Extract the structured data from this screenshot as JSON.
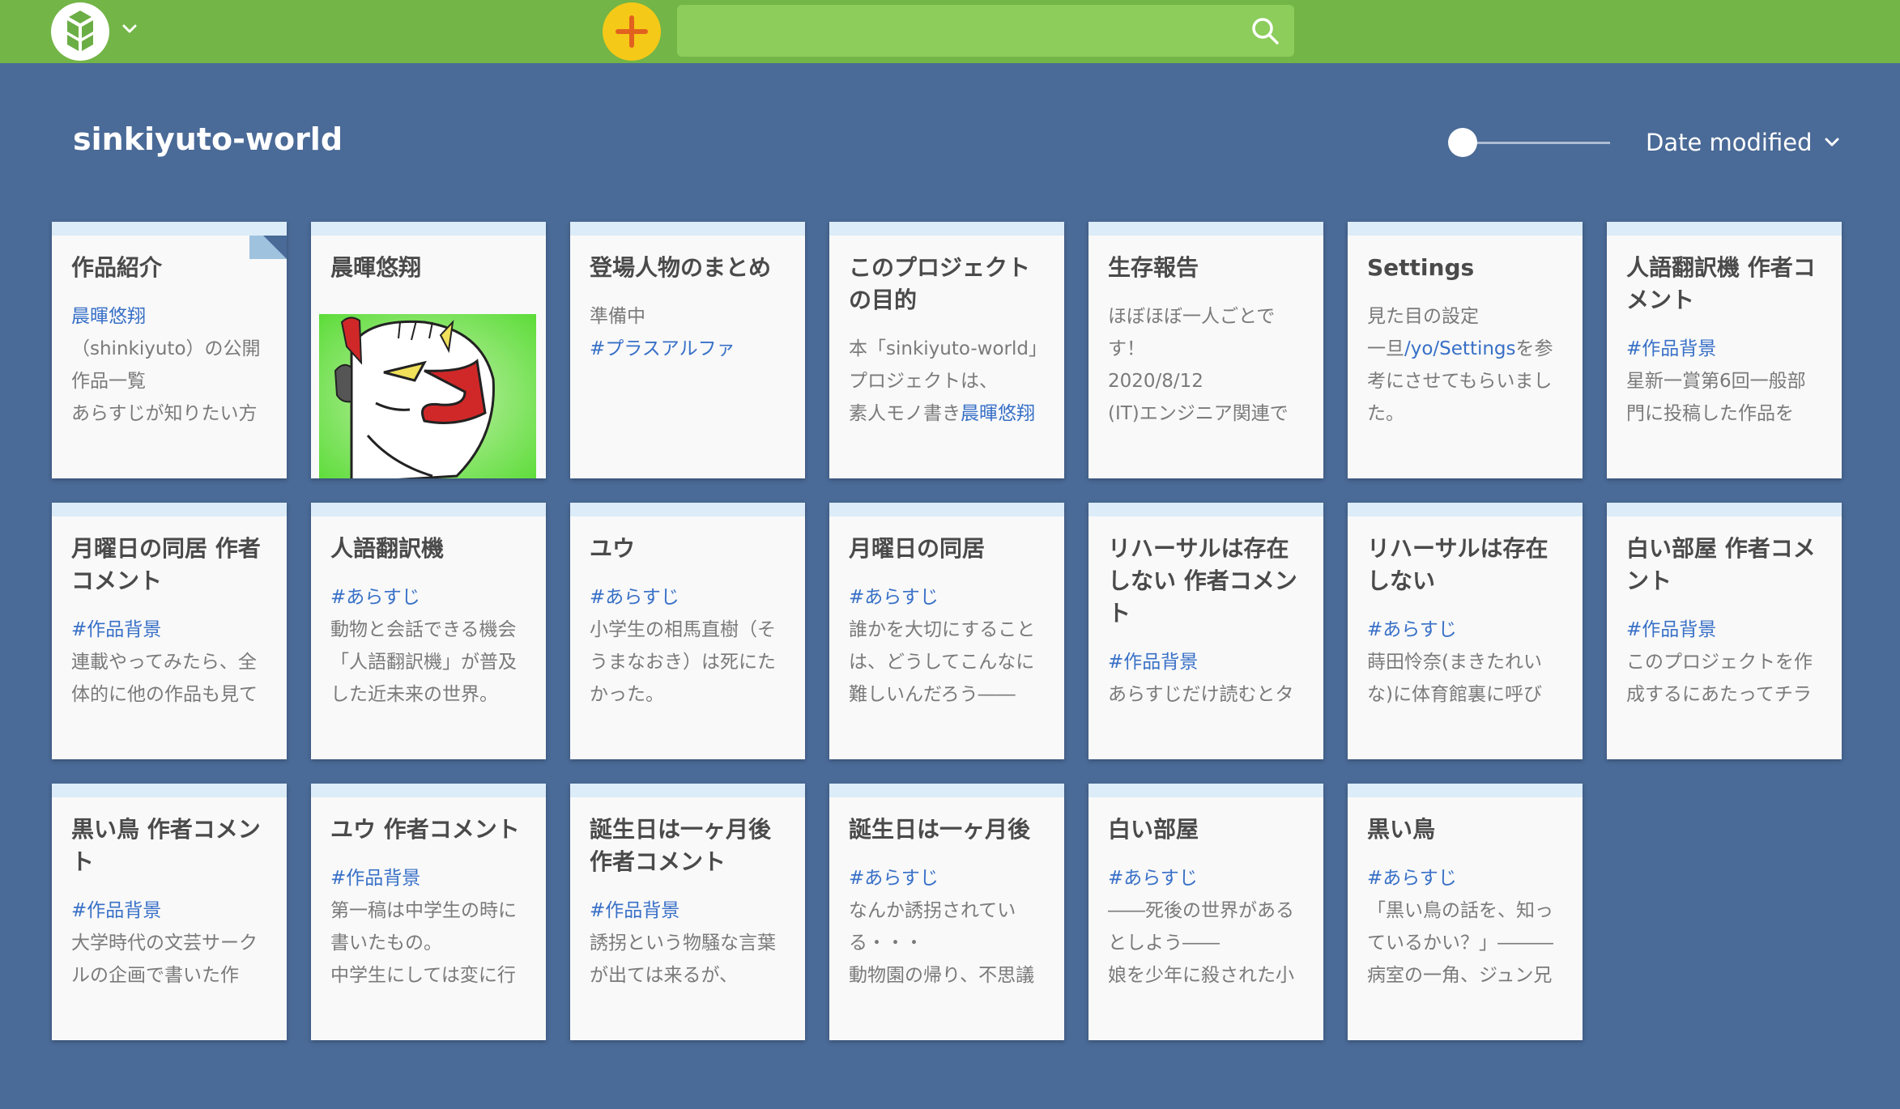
{
  "header": {
    "logo_icon": "gyazo-style-logo-icon",
    "add_icon": "plus-icon",
    "search": {
      "value": "",
      "placeholder": ""
    },
    "search_icon": "search-icon"
  },
  "project": {
    "title": "sinkiyuto-world",
    "sort_label": "Date modified"
  },
  "colors": {
    "topbar": "#73b547",
    "search_bg": "#8ccd5b",
    "add_button": "#f5c918",
    "background": "#4a6a97",
    "card_header": "#dcecf8",
    "link": "#3870c7"
  },
  "cards": [
    {
      "title": "作品紹介",
      "lines": [
        [
          "link:晨暉悠翔"
        ],
        [
          "（shinkiyuto）の公開"
        ],
        [
          "作品一覧"
        ],
        [
          "あらすじが知りたい方"
        ]
      ],
      "dogear": true
    },
    {
      "title": "晨暉悠翔",
      "image": "mask-portrait-illustration"
    },
    {
      "title": "登場人物のまとめ",
      "lines": [
        [
          "準備中"
        ],
        [
          "link:#プラスアルファ"
        ]
      ]
    },
    {
      "title": "このプロジェクトの目的",
      "lines": [
        [
          "本「sinkiyuto-world」"
        ],
        [
          "プロジェクトは、"
        ],
        [
          "素人モノ書き",
          "link:晨暉悠翔"
        ]
      ]
    },
    {
      "title": "生存報告",
      "lines": [
        [
          "ほぼほぼ一人ごとで"
        ],
        [
          "す！"
        ],
        [
          "2020/8/12"
        ],
        [
          "(IT)エンジニア関連で"
        ]
      ]
    },
    {
      "title": "Settings",
      "lines": [
        [
          "見た目の設定"
        ],
        [
          "一旦",
          "link:/yo/Settings",
          "を参"
        ],
        [
          "考にさせてもらいまし"
        ],
        [
          "た。"
        ]
      ]
    },
    {
      "title": "人語翻訳機 作者コメント",
      "lines": [
        [
          "link:#作品背景"
        ],
        [
          "星新一賞第6回一般部"
        ],
        [
          "門に投稿した作品を"
        ]
      ]
    },
    {
      "title": "月曜日の同居 作者コメント",
      "lines": [
        [
          "link:#作品背景"
        ],
        [
          "連載やってみたら、全"
        ],
        [
          "体的に他の作品も見て"
        ]
      ]
    },
    {
      "title": "人語翻訳機",
      "lines": [
        [
          "link:#あらすじ"
        ],
        [
          "動物と会話できる機会"
        ],
        [
          "「人語翻訳機」が普及"
        ],
        [
          "した近未来の世界。"
        ]
      ]
    },
    {
      "title": "ユウ",
      "lines": [
        [
          "link:#あらすじ"
        ],
        [
          "小学生の相馬直樹（そ"
        ],
        [
          "うまなおき）は死にた"
        ],
        [
          "かった。"
        ]
      ]
    },
    {
      "title": "月曜日の同居",
      "lines": [
        [
          "link:#あらすじ"
        ],
        [
          "誰かを大切にすること"
        ],
        [
          "は、どうしてこんなに"
        ],
        [
          "難しいんだろう――"
        ]
      ]
    },
    {
      "title": "リハーサルは存在しない 作者コメント",
      "lines": [
        [
          "link:#作品背景"
        ],
        [
          "あらすじだけ読むとタ"
        ]
      ]
    },
    {
      "title": "リハーサルは存在しない",
      "lines": [
        [
          "link:#あらすじ"
        ],
        [
          "蒔田怜奈(まきたれい"
        ],
        [
          "な)に体育館裏に呼び"
        ]
      ]
    },
    {
      "title": "白い部屋 作者コメント",
      "lines": [
        [
          "link:#作品背景"
        ],
        [
          "このプロジェクトを作"
        ],
        [
          "成するにあたってチラ"
        ]
      ]
    },
    {
      "title": "黒い鳥 作者コメント",
      "lines": [
        [
          "link:#作品背景"
        ],
        [
          "大学時代の文芸サーク"
        ],
        [
          "ルの企画で書いた作"
        ]
      ]
    },
    {
      "title": "ユウ 作者コメント",
      "lines": [
        [
          "link:#作品背景"
        ],
        [
          "第一稿は中学生の時に"
        ],
        [
          "書いたもの。"
        ],
        [
          "中学生にしては変に行"
        ]
      ]
    },
    {
      "title": "誕生日は一ヶ月後 作者コメント",
      "lines": [
        [
          "link:#作品背景"
        ],
        [
          "誘拐という物騒な言葉"
        ],
        [
          "が出ては来るが、"
        ]
      ]
    },
    {
      "title": "誕生日は一ヶ月後",
      "lines": [
        [
          "link:#あらすじ"
        ],
        [
          "なんか誘拐されてい"
        ],
        [
          "る・・・"
        ],
        [
          "動物園の帰り、不思議"
        ]
      ]
    },
    {
      "title": "白い部屋",
      "lines": [
        [
          "link:#あらすじ"
        ],
        [
          "――死後の世界がある"
        ],
        [
          "としよう――"
        ],
        [
          "娘を少年に殺された小"
        ]
      ]
    },
    {
      "title": "黒い鳥",
      "lines": [
        [
          "link:#あらすじ"
        ],
        [
          "「黒い鳥の話を、知っ"
        ],
        [
          "ているかい？」―――"
        ],
        [
          "病室の一角、ジュン兄"
        ]
      ]
    }
  ]
}
